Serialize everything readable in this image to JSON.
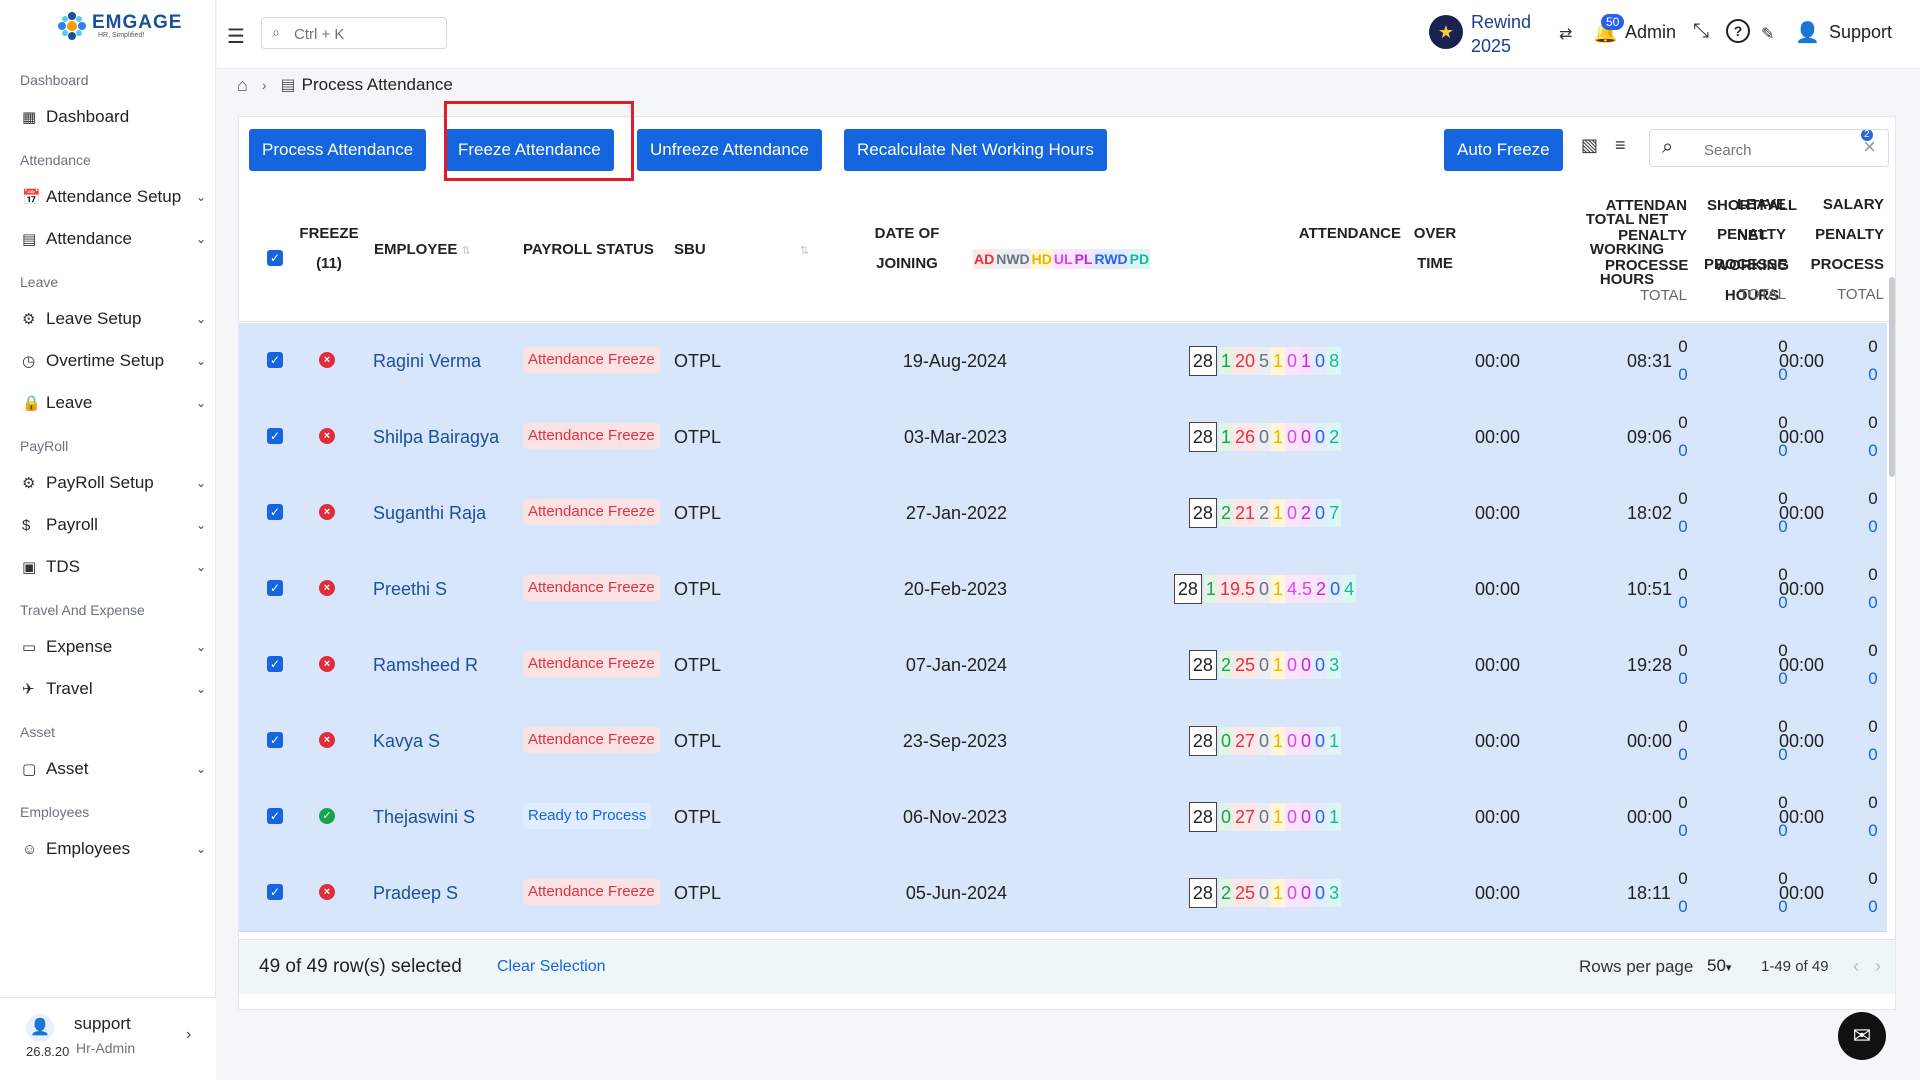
{
  "logo": {
    "word": "EMGAGE",
    "tagline": "HR, Simplified!"
  },
  "sidebar": {
    "sections": [
      {
        "label": "Dashboard",
        "items": [
          {
            "label": "Dashboard",
            "icon": "▦",
            "has_chevron": false
          }
        ]
      },
      {
        "label": "Attendance",
        "items": [
          {
            "label": "Attendance Setup",
            "icon": "📅",
            "has_chevron": true
          },
          {
            "label": "Attendance",
            "icon": "▤",
            "has_chevron": true
          }
        ]
      },
      {
        "label": "Leave",
        "items": [
          {
            "label": "Leave Setup",
            "icon": "⚙",
            "has_chevron": true
          },
          {
            "label": "Overtime Setup",
            "icon": "◷",
            "has_chevron": true
          },
          {
            "label": "Leave",
            "icon": "🔒",
            "has_chevron": true
          }
        ]
      },
      {
        "label": "PayRoll",
        "items": [
          {
            "label": "PayRoll Setup",
            "icon": "⚙",
            "has_chevron": true
          },
          {
            "label": "Payroll",
            "icon": "$",
            "has_chevron": true
          },
          {
            "label": "TDS",
            "icon": "▣",
            "has_chevron": true
          }
        ]
      },
      {
        "label": "Travel And Expense",
        "items": [
          {
            "label": "Expense",
            "icon": "▭",
            "has_chevron": true
          },
          {
            "label": "Travel",
            "icon": "✈",
            "has_chevron": true
          }
        ]
      },
      {
        "label": "Asset",
        "items": [
          {
            "label": "Asset",
            "icon": "▢",
            "has_chevron": true
          }
        ]
      },
      {
        "label": "Employees",
        "items": [
          {
            "label": "Employees",
            "icon": "☺",
            "has_chevron": true
          }
        ]
      }
    ],
    "user": {
      "name": "support",
      "role": "Hr-Admin",
      "version": "26.8.20"
    }
  },
  "header": {
    "search_placeholder": "Ctrl + K",
    "rewind_line1": "Rewind",
    "rewind_line2": "2025",
    "notif_count": "50",
    "admin_label": "Admin",
    "support_label": "Support"
  },
  "breadcrumb": {
    "page": "Process Attendance"
  },
  "toolbar": {
    "process": "Process Attendance",
    "freeze": "Freeze Attendance",
    "unfreeze": "Unfreeze Attendance",
    "recalc": "Recalculate Net Working Hours",
    "auto_freeze": "Auto Freeze",
    "filter_count": "2",
    "search_placeholder": "Search"
  },
  "columns": {
    "freeze": "FREEZE",
    "freeze_count": "(11)",
    "employee": "EMPLOYEE",
    "payroll_status": "PAYROLL STATUS",
    "sbu": "SBU",
    "doj1": "DATE OF",
    "doj2": "JOINING",
    "attendance": "ATTENDANCE",
    "ot1": "OVER",
    "ot2": "TIME",
    "net1": "TOTAL NET",
    "net2": "WORKING",
    "net3": "HOURS",
    "sf1": "SHORTFALL",
    "sf2": "NET",
    "sf3": "WORKING",
    "sf4": "HOURS",
    "ap1": "ATTENDAN",
    "ap2": "PENALTY",
    "ap3": "PROCESSE",
    "ap4": "TOTAL",
    "lp1": "LEAVE",
    "lp2": "PENALTY",
    "lp3": "PROCESSE",
    "lp4": "TOTAL",
    "sp1": "SALARY",
    "sp2": "PENALTY",
    "sp3": "PROCESS",
    "sp4": "TOTAL",
    "att_codes": [
      {
        "code": "AD",
        "color": "#e0313f",
        "bg": "#fde7e9"
      },
      {
        "code": "NWD",
        "color": "#6b7280",
        "bg": "#eceef1"
      },
      {
        "code": "HD",
        "color": "#e8b400",
        "bg": "#fff6d6"
      },
      {
        "code": "UL",
        "color": "#d946ef",
        "bg": "#fbe5fd"
      },
      {
        "code": "PL",
        "color": "#c026d3",
        "bg": "#f7e3fb"
      },
      {
        "code": "RWD",
        "color": "#2563eb",
        "bg": "#e3ecfd"
      },
      {
        "code": "PD",
        "color": "#14b8a6",
        "bg": "#dcf7f2"
      }
    ]
  },
  "colors": {
    "p": "#16a34a",
    "ad": "#e0313f",
    "nwd": "#6b7280",
    "hd": "#e8b400",
    "ul": "#d946ef",
    "pl": "#c026d3",
    "rwd": "#2563eb",
    "pd": "#14b8a6"
  },
  "rows": [
    {
      "emp": "Ragini Verma",
      "status": "frozen",
      "pay": "Attendance Freeze",
      "sbu": "OTPL",
      "doj": "19-Aug-2024",
      "att": [
        "28",
        "1",
        "20",
        "5",
        "1",
        "0",
        "1",
        "0",
        "8"
      ],
      "ot": "00:00",
      "net": "08:31",
      "short": "00:00",
      "pen": [
        "0",
        "0",
        "0",
        "0",
        "0",
        "0"
      ]
    },
    {
      "emp": "Shilpa Bairagya",
      "status": "frozen",
      "pay": "Attendance Freeze",
      "sbu": "OTPL",
      "doj": "03-Mar-2023",
      "att": [
        "28",
        "1",
        "26",
        "0",
        "1",
        "0",
        "0",
        "0",
        "2"
      ],
      "ot": "00:00",
      "net": "09:06",
      "short": "00:00",
      "pen": [
        "0",
        "0",
        "0",
        "0",
        "0",
        "0"
      ]
    },
    {
      "emp": "Suganthi Raja",
      "status": "frozen",
      "pay": "Attendance Freeze",
      "sbu": "OTPL",
      "doj": "27-Jan-2022",
      "att": [
        "28",
        "2",
        "21",
        "2",
        "1",
        "0",
        "2",
        "0",
        "7"
      ],
      "ot": "00:00",
      "net": "18:02",
      "short": "00:00",
      "pen": [
        "0",
        "0",
        "0",
        "0",
        "0",
        "0"
      ]
    },
    {
      "emp": "Preethi S",
      "status": "frozen",
      "pay": "Attendance Freeze",
      "sbu": "OTPL",
      "doj": "20-Feb-2023",
      "att": [
        "28",
        "1",
        "19.5",
        "0",
        "1",
        "4.5",
        "2",
        "0",
        "4"
      ],
      "ot": "00:00",
      "net": "10:51",
      "short": "00:00",
      "pen": [
        "0",
        "0",
        "0",
        "0",
        "0",
        "0"
      ]
    },
    {
      "emp": "Ramsheed R",
      "status": "frozen",
      "pay": "Attendance Freeze",
      "sbu": "OTPL",
      "doj": "07-Jan-2024",
      "att": [
        "28",
        "2",
        "25",
        "0",
        "1",
        "0",
        "0",
        "0",
        "3"
      ],
      "ot": "00:00",
      "net": "19:28",
      "short": "00:00",
      "pen": [
        "0",
        "0",
        "0",
        "0",
        "0",
        "0"
      ]
    },
    {
      "emp": "Kavya S",
      "status": "frozen",
      "pay": "Attendance Freeze",
      "sbu": "OTPL",
      "doj": "23-Sep-2023",
      "att": [
        "28",
        "0",
        "27",
        "0",
        "1",
        "0",
        "0",
        "0",
        "1"
      ],
      "ot": "00:00",
      "net": "00:00",
      "short": "00:00",
      "pen": [
        "0",
        "0",
        "0",
        "0",
        "0",
        "0"
      ]
    },
    {
      "emp": "Thejaswini S",
      "status": "ready",
      "pay": "Ready to Process",
      "sbu": "OTPL",
      "doj": "06-Nov-2023",
      "att": [
        "28",
        "0",
        "27",
        "0",
        "1",
        "0",
        "0",
        "0",
        "1"
      ],
      "ot": "00:00",
      "net": "00:00",
      "short": "00:00",
      "pen": [
        "0",
        "0",
        "0",
        "0",
        "0",
        "0"
      ]
    },
    {
      "emp": "Pradeep S",
      "status": "frozen",
      "pay": "Attendance Freeze",
      "sbu": "OTPL",
      "doj": "05-Jun-2024",
      "att": [
        "28",
        "2",
        "25",
        "0",
        "1",
        "0",
        "0",
        "0",
        "3"
      ],
      "ot": "00:00",
      "net": "18:11",
      "short": "00:00",
      "pen": [
        "0",
        "0",
        "0",
        "0",
        "0",
        "0"
      ]
    }
  ],
  "footer": {
    "selected": "49 of 49 row(s) selected",
    "clear": "Clear Selection",
    "rpp_label": "Rows per page",
    "rpp_value": "50",
    "range": "1-49 of 49"
  }
}
